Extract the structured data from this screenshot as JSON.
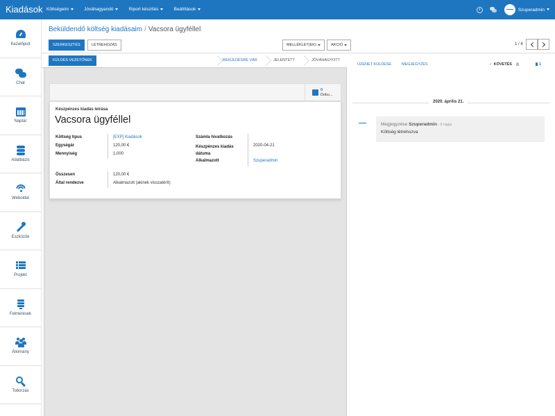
{
  "app": {
    "brand": "Kiadások"
  },
  "topnav": {
    "menu": [
      "Költségeim",
      "Jóváhagyandó",
      "Riport készítés",
      "Beállítások"
    ],
    "user": "Szuperadmin"
  },
  "sidebar": {
    "items": [
      {
        "label": "Kezelőpult",
        "icon": "dashboard-icon"
      },
      {
        "label": "Chat",
        "icon": "chat-icon"
      },
      {
        "label": "Naptár",
        "icon": "calendar-icon"
      },
      {
        "label": "Adatbázis",
        "icon": "database-icon"
      },
      {
        "label": "Weboldal",
        "icon": "wifi-icon"
      },
      {
        "label": "Eszközök",
        "icon": "wrench-icon"
      },
      {
        "label": "Projekt",
        "icon": "list-icon"
      },
      {
        "label": "Felmérések",
        "icon": "survey-icon"
      },
      {
        "label": "Állomány",
        "icon": "users-icon"
      },
      {
        "label": "Toborzás",
        "icon": "search-icon"
      }
    ]
  },
  "breadcrumb": {
    "parent": "Beküldendő költség kiadásaim",
    "separator": "/",
    "current": "Vacsora ügyféllel"
  },
  "toolbar": {
    "edit": "Szerkesztés",
    "create": "Létrehozás",
    "attachments": "Melléklet(ek)",
    "action": "Akció",
    "pager": "1 / 4"
  },
  "statusbar": {
    "send_button": "Küldés vezetőnek",
    "steps": [
      "Beküldésre vár",
      "Jelentett",
      "Jóváhagyott"
    ],
    "active_step": 0
  },
  "sheet": {
    "doc_count": "0",
    "doc_label": "Doku...",
    "desc_label": "Készpénzes kiadás leírása",
    "title": "Vacsora ügyféllel",
    "left_fields": [
      {
        "label": "Költség típus",
        "value": "[EXP] Kiadások",
        "link": true
      },
      {
        "label": "Egységár",
        "value": "120,00 €",
        "link": false
      },
      {
        "label": "Mennyiség",
        "value": "1,000",
        "link": false
      }
    ],
    "right_fields": [
      {
        "label": "Számla hivatkozás",
        "value": ""
      },
      {
        "label": "Készpénzes kiadás dátuma",
        "value": "2020-04-21"
      },
      {
        "label": "Alkalmazott",
        "value": "Szuperadmin"
      }
    ],
    "total_label": "Összesen",
    "total_value": "120,00 €",
    "paid_label": "Által rendezve",
    "paid_value": "Alkalmazott (akinek visszatérít)"
  },
  "chatter": {
    "send_message": "Üzenet küldése",
    "log_note": "Megjegyzés",
    "follow": "Követés",
    "followers": "1",
    "date": "2020. április 21.",
    "message": {
      "prefix": "Megjegyzése",
      "author": "Szuperadmin",
      "ago": "- 6 napja",
      "body": "Költség létrehozva"
    }
  },
  "colors": {
    "primary": "#1f76c0",
    "sheet_bg": "#e4e4e4"
  }
}
